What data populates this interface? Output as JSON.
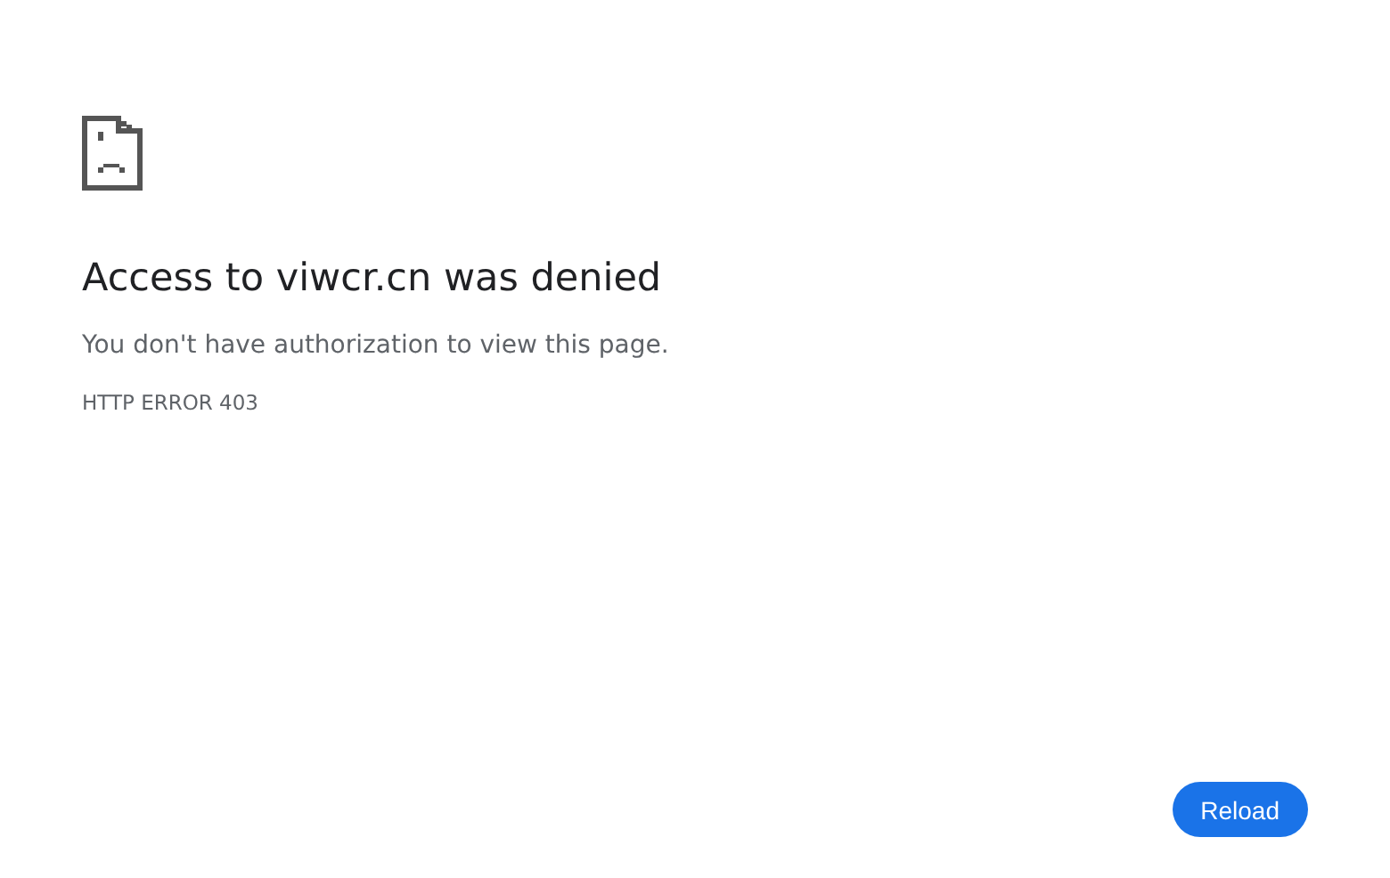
{
  "title": "Access to viwcr.cn was denied",
  "message": "You don't have authorization to view this page.",
  "error_code": "HTTP ERROR 403",
  "buttons": [
    "Reload"
  ]
}
